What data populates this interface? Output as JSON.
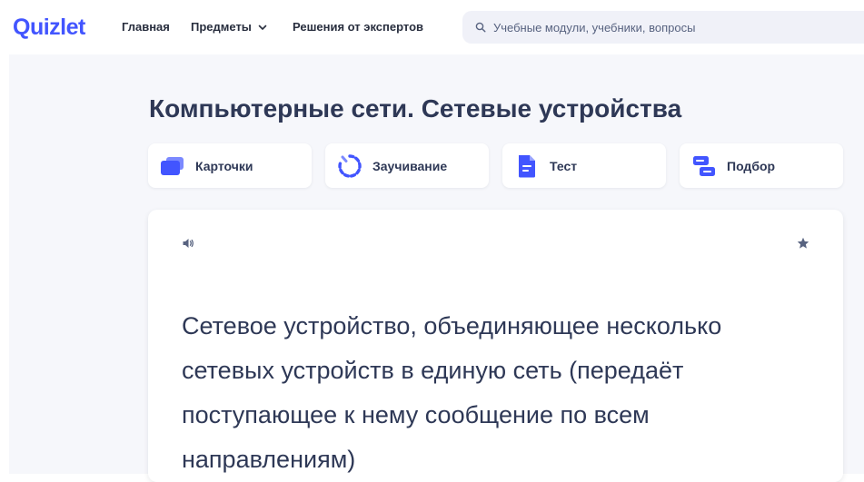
{
  "header": {
    "logo": "Quizlet",
    "nav": {
      "home": "Главная",
      "subjects": "Предметы",
      "solutions": "Решения от экспертов"
    },
    "search": {
      "placeholder": "Учебные модули, учебники, вопросы"
    }
  },
  "page": {
    "title": "Компьютерные сети. Сетевые устройства"
  },
  "modes": [
    {
      "label": "Карточки",
      "icon": "flashcards-icon"
    },
    {
      "label": "Заучивание",
      "icon": "learn-icon"
    },
    {
      "label": "Тест",
      "icon": "test-icon"
    },
    {
      "label": "Подбор",
      "icon": "match-icon"
    }
  ],
  "flashcard": {
    "term": "Сетевое устройство, объединяющее несколько сетевых устройств в единую сеть (передаёт поступающее к нему сообщение по всем направлениям)",
    "audio_icon": "speaker-icon",
    "star_icon": "star-icon"
  },
  "colors": {
    "brand": "#4255ff",
    "background": "#f6f7fb",
    "text": "#2e3856"
  }
}
